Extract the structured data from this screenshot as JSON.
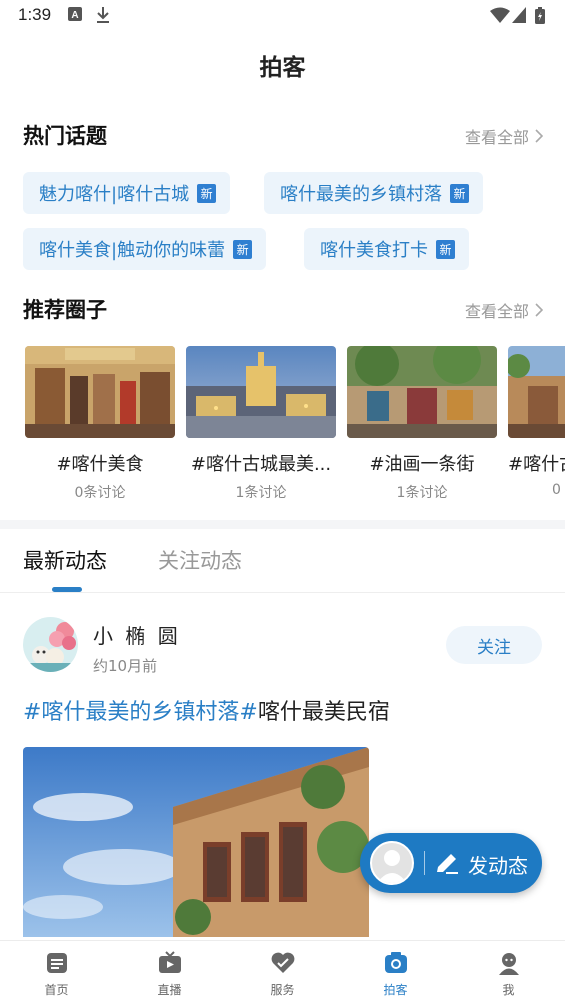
{
  "status_bar": {
    "time": "1:39"
  },
  "page": {
    "title": "拍客"
  },
  "hot_topics": {
    "title": "热门话题",
    "see_all": "查看全部",
    "badge": "新",
    "items": [
      {
        "label": "魅力喀什|喀什古城"
      },
      {
        "label": "喀什最美的乡镇村落"
      },
      {
        "label": "喀什美食|触动你的味蕾"
      },
      {
        "label": "喀什美食打卡"
      }
    ]
  },
  "circles": {
    "title": "推荐圈子",
    "see_all": "查看全部",
    "items": [
      {
        "name": "#喀什美食",
        "count": "0条讨论"
      },
      {
        "name": "#喀什古城最美...",
        "count": "1条讨论"
      },
      {
        "name": "#油画一条街",
        "count": "1条讨论"
      },
      {
        "name": "#喀什古",
        "count": "0"
      }
    ]
  },
  "feed_tabs": [
    {
      "label": "最新动态",
      "active": true
    },
    {
      "label": "关注动态",
      "active": false
    }
  ],
  "post": {
    "user": "小 椭 圆",
    "time": "约10月前",
    "follow": "关注",
    "tag": "#喀什最美的乡镇村落#",
    "text": "喀什最美民宿"
  },
  "fab": {
    "label": "发动态",
    "icon": "pencil-icon"
  },
  "nav": [
    {
      "label": "首页",
      "icon": "home-icon",
      "active": false
    },
    {
      "label": "直播",
      "icon": "tv-icon",
      "active": false
    },
    {
      "label": "服务",
      "icon": "heart-icon",
      "active": false
    },
    {
      "label": "拍客",
      "icon": "camera-icon",
      "active": true
    },
    {
      "label": "我",
      "icon": "user-icon",
      "active": false
    }
  ],
  "colors": {
    "accent": "#2a7fc6",
    "fab": "#1e7ac3",
    "chip_bg": "#ecf4fb"
  }
}
